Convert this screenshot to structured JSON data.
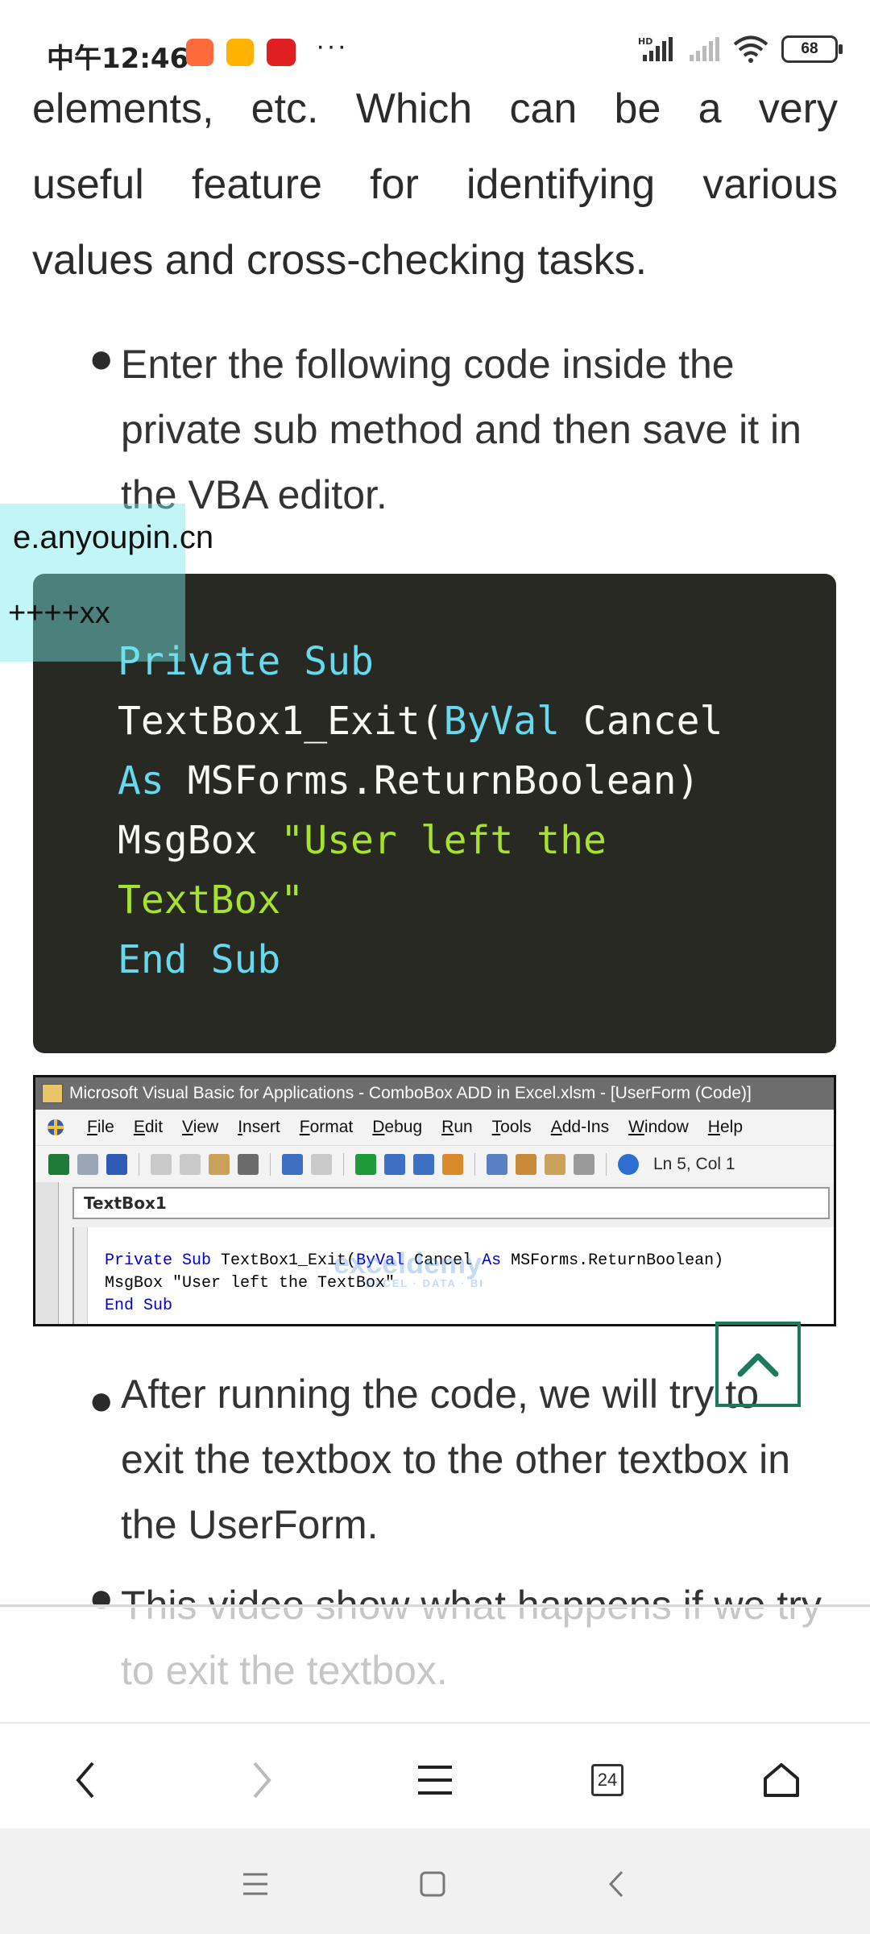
{
  "status_bar": {
    "time": "中午12:46",
    "more": "···",
    "battery": "68",
    "network_label": "HD"
  },
  "article": {
    "intro_lines": [
      "elements, etc. Which can be a very",
      "useful feature for identifying various",
      "values and cross-checking tasks."
    ],
    "bullet1": "Enter the following code inside the private sub method and then save it in the VBA editor.",
    "bullet2": "After running the code, we will try to exit the textbox to the other textbox in the UserForm.",
    "bullet3": "This video show what happens if we try to exit the textbox."
  },
  "watermark_overlay": {
    "domain": "e.anyoupin.cn",
    "marks": "++++xx"
  },
  "code_block": {
    "line1_kw": "Private Sub",
    "line2_text": "TextBox1_Exit(",
    "line2_kw": "ByVal",
    "line2_rest": " Cancel",
    "line3_kw": "As",
    "line3_rest": " MSForms.ReturnBoolean)",
    "line4_text": "MsgBox ",
    "line4_str": "\"User left the",
    "line5_str": "TextBox\"",
    "line6_kw": "End Sub"
  },
  "vba_editor": {
    "title": "Microsoft Visual Basic for Applications - ComboBox ADD in Excel.xlsm - [UserForm (Code)]",
    "menu": [
      "File",
      "Edit",
      "View",
      "Insert",
      "Format",
      "Debug",
      "Run",
      "Tools",
      "Add-Ins",
      "Window",
      "Help"
    ],
    "position": "Ln 5, Col 1",
    "object_combo": "TextBox1",
    "code_line1_a": "Private Sub",
    "code_line1_b": " TextBox1_Exit(",
    "code_line1_c": "ByVal",
    "code_line1_d": " Cancel ",
    "code_line1_e": "As",
    "code_line1_f": " MSForms.ReturnBoolean)",
    "code_line2": "MsgBox \"User left the TextBox\"",
    "code_line3": "End Sub",
    "watermark": "exceldemy",
    "watermark_sub": "EXCEL · DATA · BI"
  },
  "browser_bar": {
    "tab_count": "24"
  },
  "colors": {
    "code_bg": "#282923",
    "keyword": "#66d9ef",
    "string": "#a6e22e",
    "accent": "#1a7a5e"
  }
}
